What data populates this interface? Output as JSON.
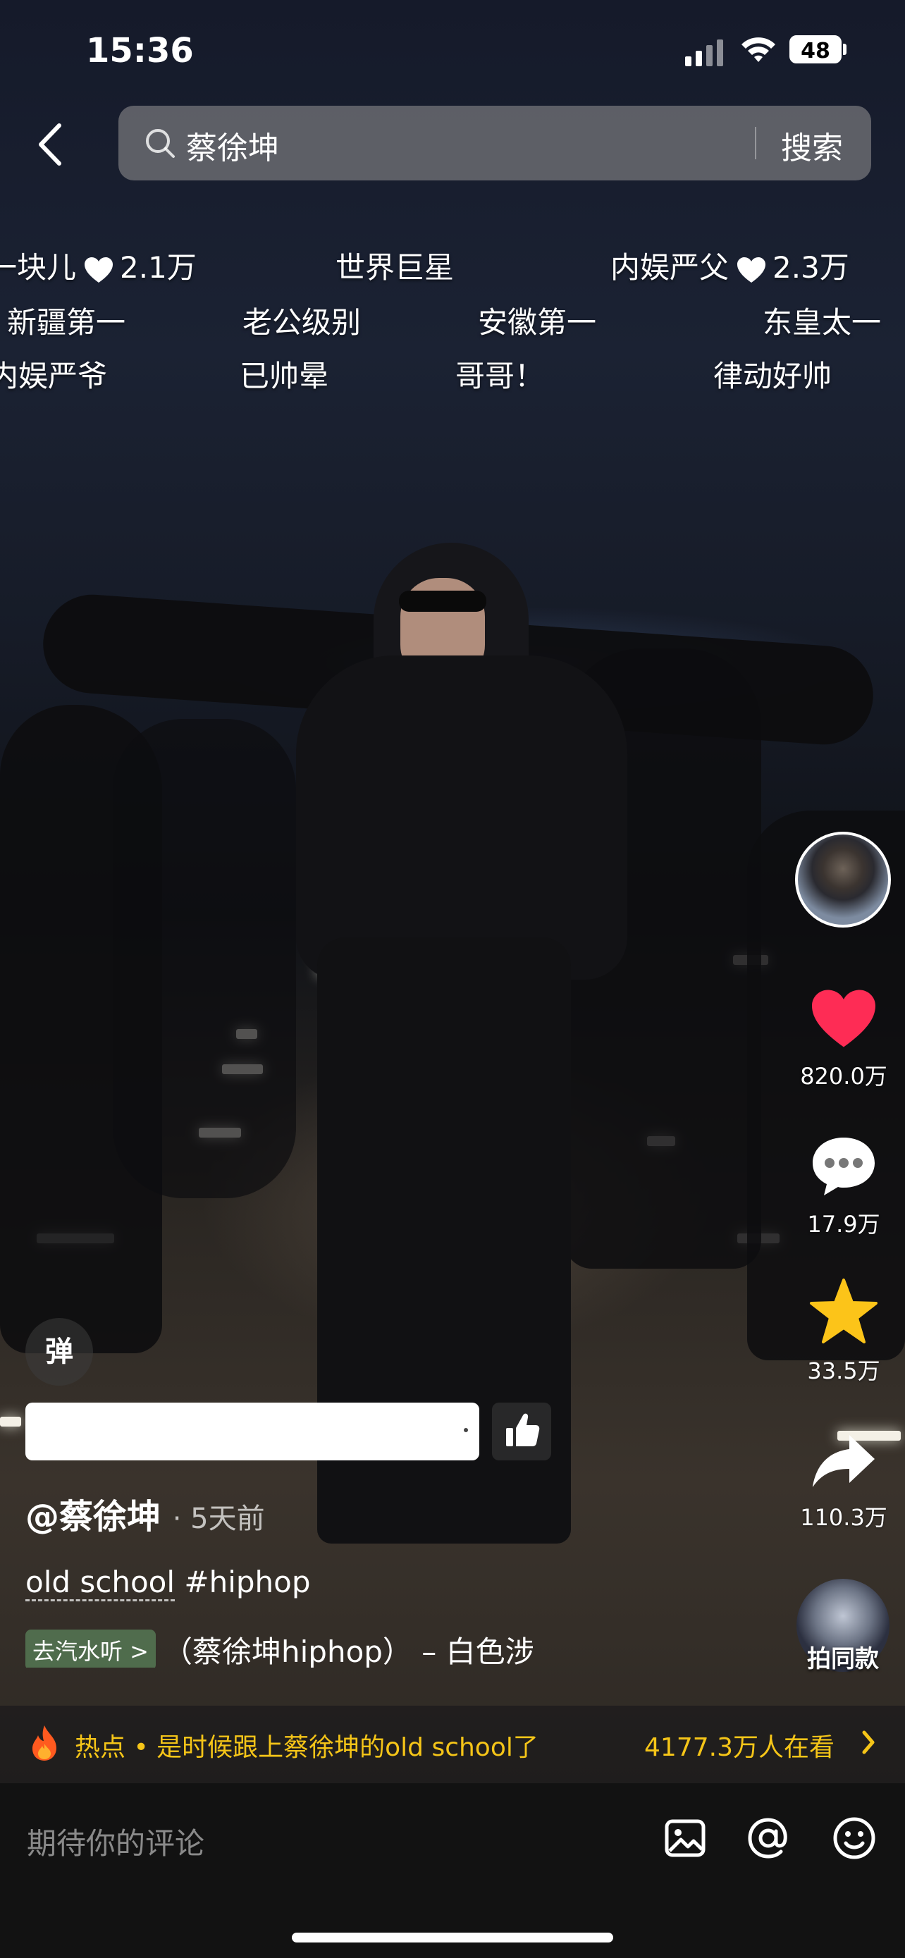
{
  "status_bar": {
    "time": "15:36",
    "battery": "48"
  },
  "search": {
    "query": "蔡徐坤",
    "button_label": "搜索"
  },
  "danmaku": [
    {
      "text": "一块儿",
      "likes": "2.1万"
    },
    {
      "text": "世界巨星"
    },
    {
      "text": "内娱严父",
      "likes": "2.3万"
    },
    {
      "text": "新疆第一"
    },
    {
      "text": "老公级别"
    },
    {
      "text": "安徽第一"
    },
    {
      "text": "东皇太一"
    },
    {
      "text": "内娱严爷"
    },
    {
      "text": "已帅晕"
    },
    {
      "text": "哥哥！"
    },
    {
      "text": "律动好帅"
    }
  ],
  "actions": {
    "likes": "820.0万",
    "comments": "17.9万",
    "favorites": "33.5万",
    "shares": "110.3万",
    "same_style": "拍同款"
  },
  "danmaku_toggle": "弹",
  "post": {
    "author": "@蔡徐坤",
    "time_ago": "· 5天前",
    "caption_part1": "old school",
    "caption_part2": " #hiphop",
    "music_chip": "去汽水听 >",
    "music_title": "（蔡徐坤hiphop） – 白色涉"
  },
  "hot": {
    "text": "热点 • 是时候跟上蔡徐坤的old school了",
    "viewers": "4177.3万人在看"
  },
  "comment": {
    "placeholder": "期待你的评论"
  },
  "colors": {
    "like": "#fe2c55",
    "favorite": "#fcc419",
    "hot": "#f5c518"
  }
}
